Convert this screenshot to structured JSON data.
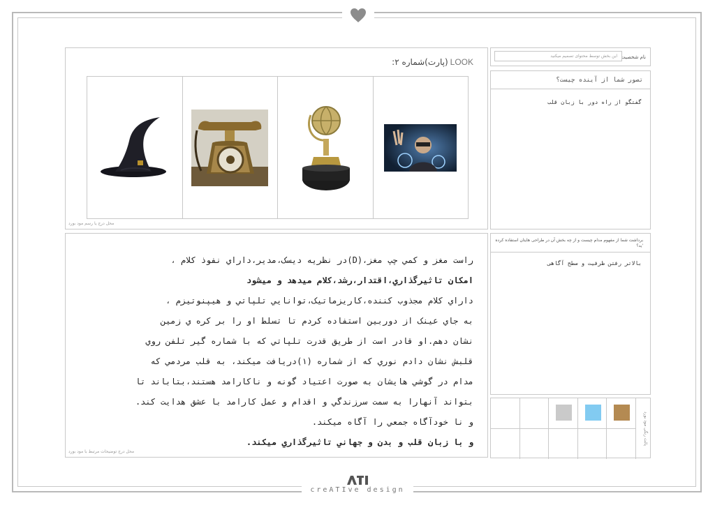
{
  "look": {
    "title_latin": "LOOK",
    "title_rest": "(پارت)شماره ۲:",
    "note": "محل درج یا رسم مود بورد",
    "images": [
      {
        "name": "wizard-hat",
        "label": "کلاه جادوگر"
      },
      {
        "name": "rotary-telephone",
        "label": "تلفن قدیمی"
      },
      {
        "name": "golden-globe-trophy",
        "label": "کره طلایی"
      },
      {
        "name": "futuristic-screen-person",
        "label": "صفحه تعاملی"
      }
    ]
  },
  "story": {
    "lines": [
      {
        "text": "راست مغز و کمي چپ مغز،(D)در نظريه ديسک،مدير،داراي نفوذ کلام ،",
        "bold": false
      },
      {
        "text": "امکان تاثيرگذاري،اقتدار،رشد،کلام ميدهد و ميشود",
        "bold": true
      },
      {
        "text": "داراي کلام مجذوب کننده،کاريزماتيک،توانايي تلپاتي و هيپنوتيزم ،",
        "bold": false
      },
      {
        "text": "به جاي عينک از دوربين استفاده کردم تا تسلط او را بر کره ي زمين",
        "bold": false
      },
      {
        "text": "نشان دهم.او قادر است از طريق قدرت تلپاتي که با شماره گير تلفن روي",
        "bold": false
      },
      {
        "text": "قلبش نشان دادم نوري که از شماره (۱)دريافت ميکند، به قلب مردمي که",
        "bold": false
      },
      {
        "text": "مدام در گوشي هايشان به صورت اعتياد گونه و ناکارامد هستند،بتاباند تا",
        "bold": false
      },
      {
        "text": "بتواند آنهارا به سمت سرزندگي و اقدام و عمل کارامد با عشق هدايت کند.",
        "bold": false
      },
      {
        "text": "و نا خودآگاه جمعي را آگاه ميکند.",
        "bold": false
      },
      {
        "text": "و با زبان قلب و بدن و جهاني تاثيرگذاري ميکند.",
        "bold": true
      }
    ],
    "note": "محل درج توضیحات مرتبط با مود بورد"
  },
  "name_field": {
    "label": "نام شخصیت",
    "placeholder": "این بخش توسط محتوای تصمیم میکنید"
  },
  "question1": {
    "heading": "تصور شما از آینده چیست؟",
    "answer": "گفتگو از راه دور با زبان قلب"
  },
  "question2": {
    "heading": "برداشت شما از مفهوم مدام چیست و از چه بخش آن در طراحی هایتان استفاده کرده 'ید؟",
    "answer": "بالاتر رفتن ظرفیت و سطح آگاهی"
  },
  "palette": {
    "label": "پالت رنگی مود بورد",
    "colors": [
      "#b48a52",
      "#82cbf1",
      "#cacaca"
    ]
  },
  "footer": {
    "brand": "creATIve design"
  }
}
